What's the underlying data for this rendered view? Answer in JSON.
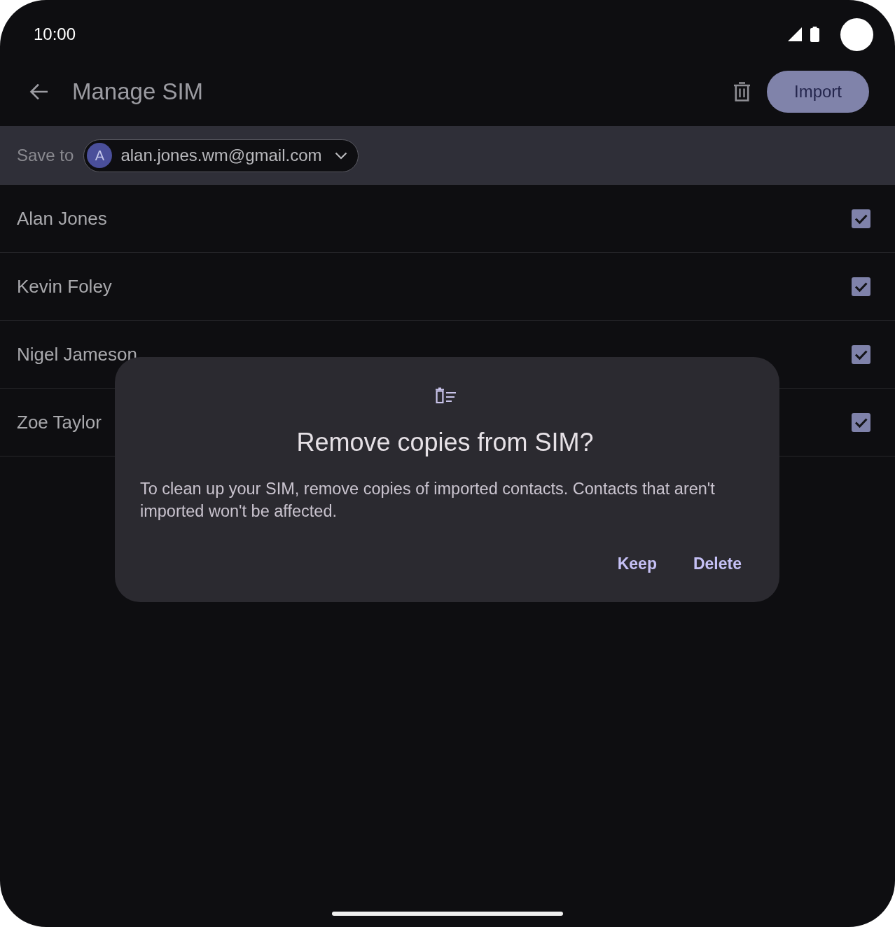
{
  "status_bar": {
    "time": "10:00"
  },
  "app_bar": {
    "title": "Manage SIM",
    "action_button": "Import"
  },
  "save_to": {
    "label": "Save to",
    "account": {
      "initial": "A",
      "email": "alan.jones.wm@gmail.com"
    }
  },
  "contacts": [
    {
      "name": "Alan Jones",
      "checked": true
    },
    {
      "name": "Kevin Foley",
      "checked": true
    },
    {
      "name": "Nigel Jameson",
      "checked": true
    },
    {
      "name": "Zoe Taylor",
      "checked": true
    }
  ],
  "dialog": {
    "title": "Remove copies from SIM?",
    "message": "To clean up your SIM, remove copies of imported contacts. Contacts that aren't imported won't be affected.",
    "buttons": [
      "Keep",
      "Delete"
    ]
  }
}
